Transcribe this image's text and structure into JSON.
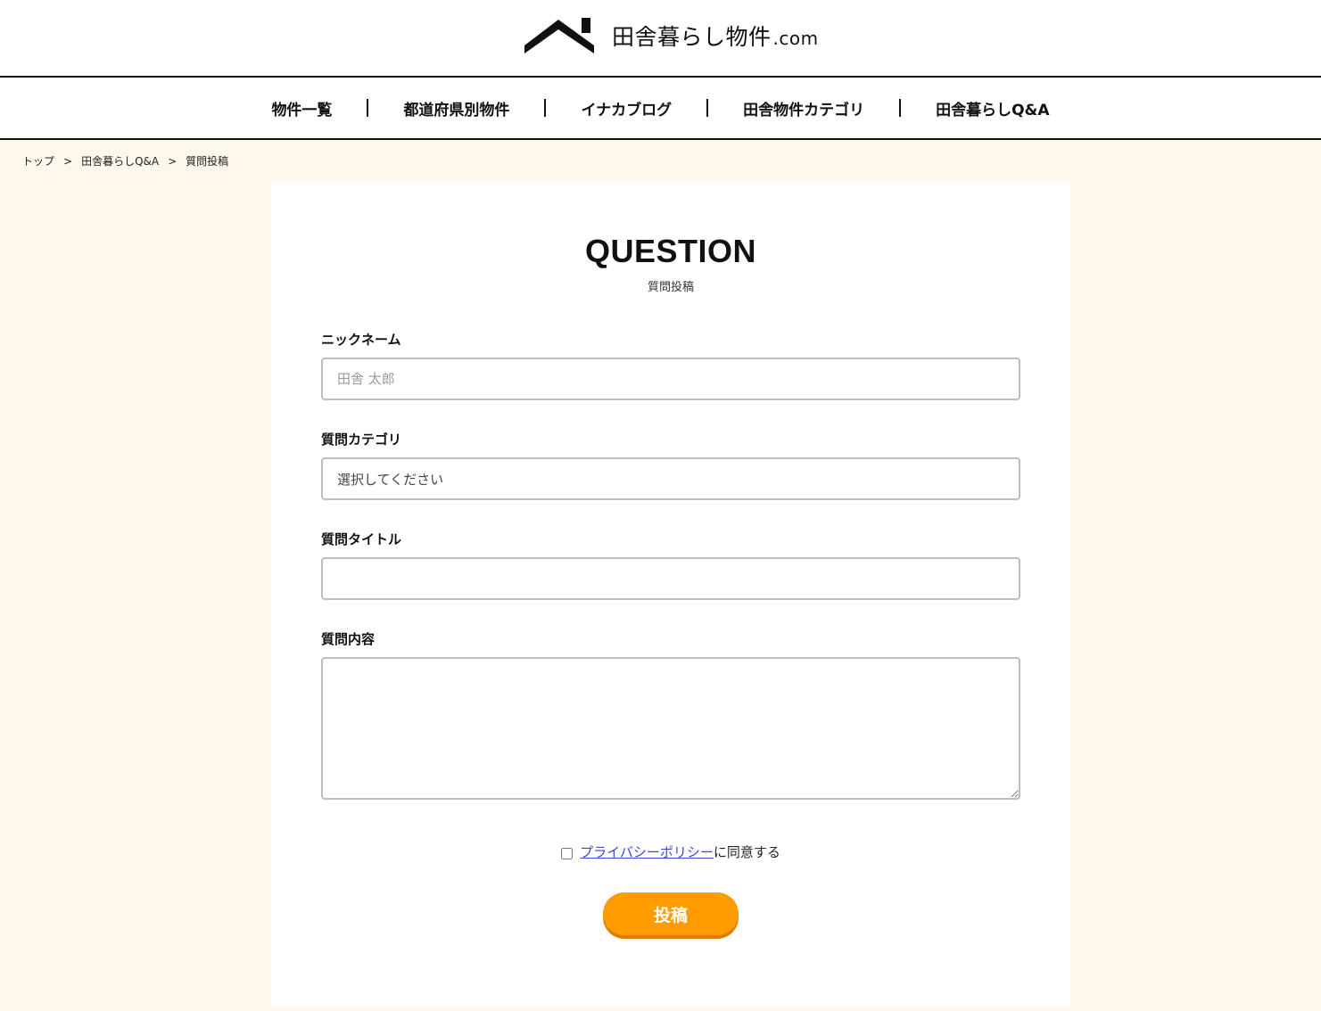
{
  "site": {
    "logo_text": "田舎暮らし物件",
    "logo_suffix": ".com"
  },
  "nav": [
    {
      "label": "物件一覧"
    },
    {
      "label": "都道府県別物件"
    },
    {
      "label": "イナカブログ"
    },
    {
      "label": "田舎物件カテゴリ"
    },
    {
      "label": "田舎暮らしQ&A"
    }
  ],
  "breadcrumb": {
    "items": [
      "トップ",
      "田舎暮らしQ&A",
      "質問投稿"
    ],
    "separator": ">"
  },
  "form": {
    "title": "QUESTION",
    "subtitle": "質問投稿",
    "nickname_label": "ニックネーム",
    "nickname_placeholder": "田舎 太郎",
    "category_label": "質問カテゴリ",
    "category_selected": "選択してください",
    "question_title_label": "質問タイトル",
    "question_body_label": "質問内容",
    "privacy_link": "プライバシーポリシー",
    "privacy_suffix": "に同意する",
    "submit_label": "投稿"
  },
  "colors": {
    "page_background": "#fef8ec",
    "accent": "#ff9c00",
    "link": "#3b49d6"
  }
}
